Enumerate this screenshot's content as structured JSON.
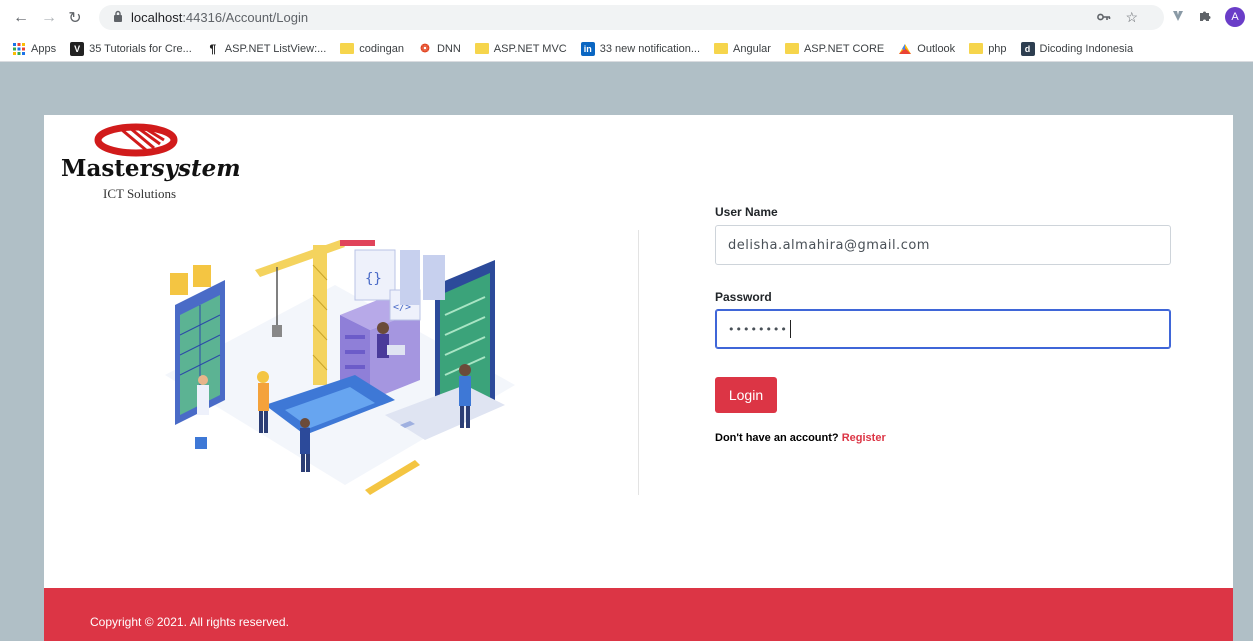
{
  "browser": {
    "url_host": "localhost",
    "url_path": ":44316/Account/Login",
    "avatar_letter": "A",
    "bookmarks": [
      {
        "label": "Apps",
        "icon": "apps-grid-icon"
      },
      {
        "label": "35 Tutorials for Cre...",
        "icon": "v-logo-icon"
      },
      {
        "label": "ASP.NET ListView:...",
        "icon": "pilcrow-icon"
      },
      {
        "label": "codingan",
        "icon": "folder-icon"
      },
      {
        "label": "DNN",
        "icon": "dnn-logo-icon"
      },
      {
        "label": "ASP.NET MVC",
        "icon": "folder-icon"
      },
      {
        "label": "33 new notification...",
        "icon": "linkedin-icon"
      },
      {
        "label": "Angular",
        "icon": "folder-icon"
      },
      {
        "label": "ASP.NET CORE",
        "icon": "folder-icon"
      },
      {
        "label": "Outlook",
        "icon": "outlook-icon"
      },
      {
        "label": "php",
        "icon": "folder-icon"
      },
      {
        "label": "Dicoding Indonesia",
        "icon": "dicoding-icon"
      }
    ]
  },
  "brand": {
    "name_a": "Master",
    "name_b": "system",
    "tagline": "ICT Solutions"
  },
  "form": {
    "username_label": "User Name",
    "username_value": "delisha.almahira@gmail.com",
    "password_label": "Password",
    "password_value": "••••••••",
    "login_label": "Login",
    "no_account_text": "Don't have an account?",
    "register_label": "Register"
  },
  "footer": {
    "copyright": "Copyright © 2021. All rights reserved."
  },
  "colors": {
    "accent": "#dc3545",
    "page_bg": "#b0bfc6",
    "focus": "#3f66d8"
  }
}
